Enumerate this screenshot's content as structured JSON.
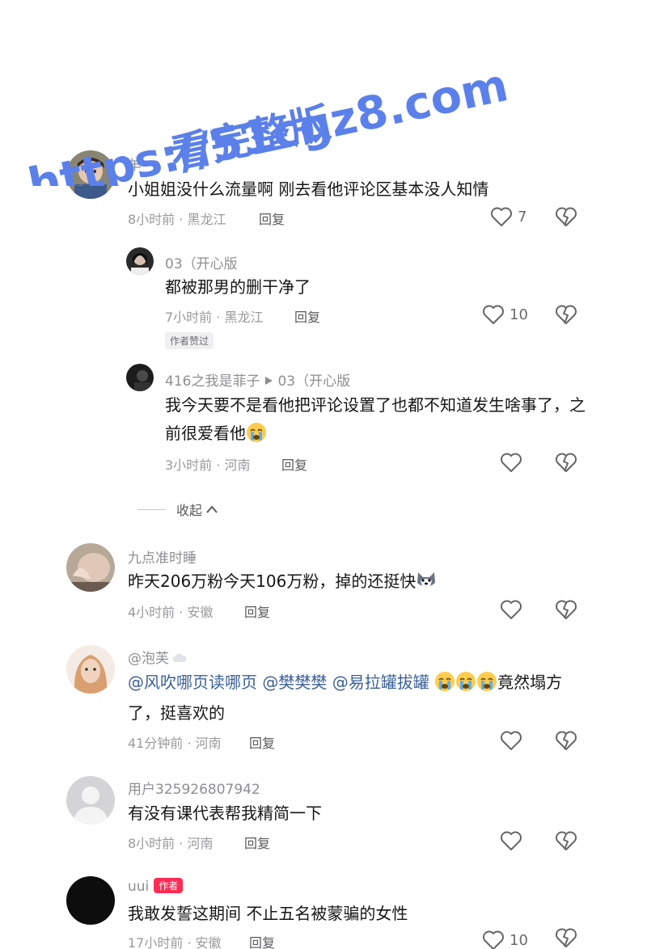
{
  "watermark": {
    "line1": "https://51cgz8.com",
    "line2": "看完整版"
  },
  "colors": {
    "text": "#161616",
    "secondary": "#8e8e93",
    "mention": "#3a5f98",
    "author_badge": "#fe2c55",
    "watermark": "#5b80ea"
  },
  "comments": [
    {
      "user": "羊",
      "text": "小姐姐没什么流量啊 刚去看他评论区基本没人知情",
      "time": "8小时前",
      "location": "黑龙江",
      "reply": "回复",
      "likes": "7"
    },
    {
      "user": "03（开心版",
      "text": "都被那男的删干净了",
      "time": "7小时前",
      "location": "黑龙江",
      "reply": "回复",
      "likes": "10",
      "badge": "作者赞过"
    },
    {
      "user": "416之我是菲子",
      "reply_to": "03（开心版",
      "text_line1": "我今天要不是看他把评论设置了也都不知道发生啥事了，之",
      "text_line2": "前很爱看他",
      "time": "3小时前",
      "location": "河南",
      "reply": "回复"
    },
    {
      "user": "九点准时睡",
      "text": "昨天206万粉今天106万粉，掉的还挺快",
      "time": "4小时前",
      "location": "安徽",
      "reply": "回复"
    },
    {
      "user": "@泡芙",
      "mentions": [
        "@风吹哪页读哪页",
        "@樊樊樊",
        "@易拉罐拔罐"
      ],
      "text_tail": "竟然塌方",
      "text_line2": "了，挺喜欢的",
      "time": "41分钟前",
      "location": "河南",
      "reply": "回复"
    },
    {
      "user": "用户325926807942",
      "text": "有没有课代表帮我精简一下",
      "time": "8小时前",
      "location": "河南",
      "reply": "回复"
    },
    {
      "user": "uui",
      "badge": "作者",
      "text": "我敢发誓这期间 不止五名被蒙骗的女性",
      "time": "17小时前",
      "location": "安徽",
      "reply": "回复",
      "likes": "10"
    }
  ],
  "collapse_label": "收起",
  "separator": "·",
  "icons": {
    "like": "heart-outline-icon",
    "dislike": "broken-heart-icon",
    "collapse": "chevron-up-icon",
    "emoji_cry": "crying-face-emoji",
    "emoji_husky": "husky-face-emoji"
  }
}
